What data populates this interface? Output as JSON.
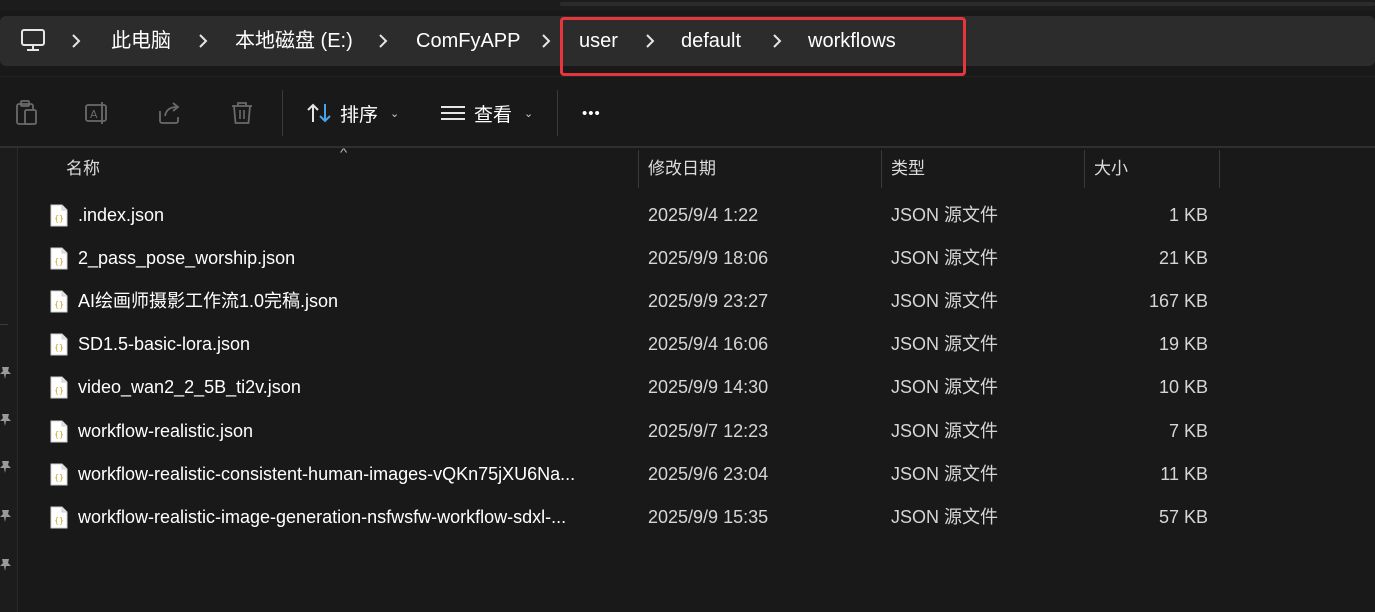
{
  "breadcrumb": {
    "items": [
      "此电脑",
      "本地磁盘 (E:)",
      "ComFyAPP",
      "user",
      "default",
      "workflows"
    ]
  },
  "toolbar": {
    "sort_label": "排序",
    "view_label": "查看",
    "more_label": "•••"
  },
  "columns": {
    "name": "名称",
    "date": "修改日期",
    "type": "类型",
    "size": "大小"
  },
  "files": [
    {
      "name": ".index.json",
      "date": "2025/9/4 1:22",
      "type": "JSON 源文件",
      "size": "1 KB"
    },
    {
      "name": "2_pass_pose_worship.json",
      "date": "2025/9/9 18:06",
      "type": "JSON 源文件",
      "size": "21 KB"
    },
    {
      "name": "AI绘画师摄影工作流1.0完稿.json",
      "date": "2025/9/9 23:27",
      "type": "JSON 源文件",
      "size": "167 KB"
    },
    {
      "name": "SD1.5-basic-lora.json",
      "date": "2025/9/4 16:06",
      "type": "JSON 源文件",
      "size": "19 KB"
    },
    {
      "name": "video_wan2_2_5B_ti2v.json",
      "date": "2025/9/9 14:30",
      "type": "JSON 源文件",
      "size": "10 KB"
    },
    {
      "name": "workflow-realistic.json",
      "date": "2025/9/7 12:23",
      "type": "JSON 源文件",
      "size": "7 KB"
    },
    {
      "name": "workflow-realistic-consistent-human-images-vQKn75jXU6Na...",
      "date": "2025/9/6 23:04",
      "type": "JSON 源文件",
      "size": "11 KB"
    },
    {
      "name": "workflow-realistic-image-generation-nsfwsfw-workflow-sdxl-...",
      "date": "2025/9/9 15:35",
      "type": "JSON 源文件",
      "size": "57 KB"
    }
  ],
  "colors": {
    "background": "#191919",
    "addressbar": "#2c2c2c",
    "highlight": "#e5363e"
  }
}
